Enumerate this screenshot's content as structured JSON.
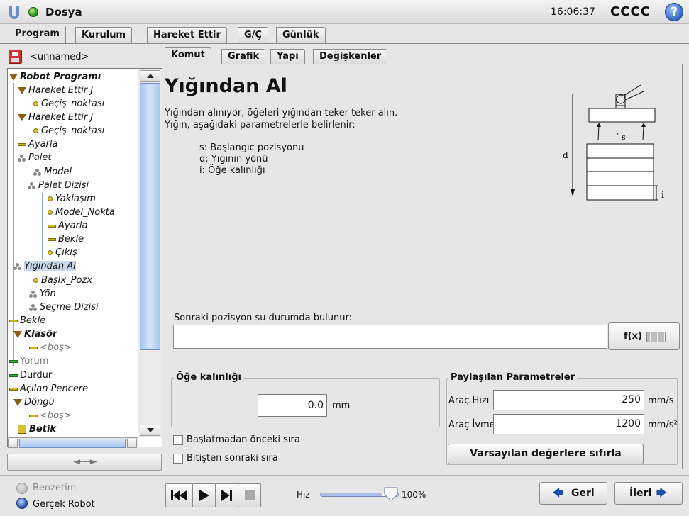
{
  "topbar": {
    "app_title": "Dosya",
    "clock": "16:06:37",
    "robot_name": "CCCC",
    "help_label": "?"
  },
  "main_tabs": [
    {
      "label": "Program",
      "active": true
    },
    {
      "label": "Kurulum",
      "active": false
    },
    {
      "label": "Hareket Ettir",
      "active": false
    },
    {
      "label": "G/Ç",
      "active": false
    },
    {
      "label": "Günlük",
      "active": false
    }
  ],
  "file": {
    "name": "<unnamed>"
  },
  "tree": [
    {
      "label": "Robot Programı",
      "icon": "triangle"
    },
    {
      "label": "Hareket Ettir J",
      "icon": "triangle"
    },
    {
      "label": "Geçiş_noktası",
      "icon": "waypoint-dot"
    },
    {
      "label": "Hareket Ettir J",
      "icon": "triangle"
    },
    {
      "label": "Geçiş_noktası",
      "icon": "waypoint-dot"
    },
    {
      "label": "Ayarla",
      "icon": "dash"
    },
    {
      "label": "Palet",
      "icon": "pallet"
    },
    {
      "label": "Model",
      "icon": "pallet"
    },
    {
      "label": "Palet Dizisi",
      "icon": "pallet"
    },
    {
      "label": "Yaklaşım",
      "icon": "waypoint-dot"
    },
    {
      "label": "Model_Nokta",
      "icon": "waypoint-dot"
    },
    {
      "label": "Ayarla",
      "icon": "dash"
    },
    {
      "label": "Bekle",
      "icon": "dash"
    },
    {
      "label": "Çıkış",
      "icon": "waypoint-dot"
    },
    {
      "label": "Yığından Al",
      "icon": "pallet"
    },
    {
      "label": "BaşIx_Pozx",
      "icon": "waypoint-dot"
    },
    {
      "label": "Yön",
      "icon": "pallet"
    },
    {
      "label": "Seçme Dizisi",
      "icon": "pallet"
    },
    {
      "label": "Bekle",
      "icon": "dash"
    },
    {
      "label": "Klasör",
      "icon": "triangle"
    },
    {
      "label": "<boş>",
      "icon": "dash"
    },
    {
      "label": "Yorum",
      "icon": "dash-green"
    },
    {
      "label": "Durdur",
      "icon": "dash-green"
    },
    {
      "label": "Açılan Pencere",
      "icon": "dash"
    },
    {
      "label": "Döngü",
      "icon": "triangle"
    },
    {
      "label": "<boş>",
      "icon": "dash"
    },
    {
      "label": "Betik",
      "icon": "script"
    }
  ],
  "collapse_button": {
    "label": "◄----►"
  },
  "sub_tabs": [
    {
      "label": "Komut",
      "active": true
    },
    {
      "label": "Grafik",
      "active": false
    },
    {
      "label": "Yapı",
      "active": false
    },
    {
      "label": "Değişkenler",
      "active": false
    }
  ],
  "main": {
    "title": "Yığından Al",
    "description_1": "Yığından alınıyor, öğeleri yığından teker teker alın.",
    "description_2": "Yığın, aşağıdaki parametrelerle belirlenir:",
    "params": [
      "s: Başlangıç pozisyonu",
      "d: Yığının yönü",
      "i: Öğe kalınlığı"
    ],
    "diagram": {
      "d_label": "d",
      "s_label": "s",
      "i_label": "i"
    },
    "next_position_label": "Sonraki pozisyon şu durumda bulunur:",
    "next_position_value": "",
    "fx_label": "f(x)",
    "thickness_group": {
      "title": "Öğe kalınlığı",
      "value": "0.0",
      "unit": "mm"
    },
    "start_seq_label": "Başlatmadan önceki sıra",
    "end_seq_label": "Bitişten sonraki sıra",
    "shared_params": {
      "title": "Paylaşılan Parametreler",
      "tool_speed_label": "Araç Hızı",
      "tool_speed_value": "250",
      "tool_speed_unit": "mm/s",
      "tool_accel_label": "Araç İvmesi",
      "tool_accel_value": "1200",
      "tool_accel_unit": "mm/s²",
      "reset_label": "Varsayılan değerlere sıfırla"
    }
  },
  "bottom": {
    "sim_label": "Benzetim",
    "real_label": "Gerçek Robot",
    "speed_label": "Hız",
    "speed_value": "100%",
    "speed_fraction": 1.0,
    "back_label": "Geri",
    "next_label": "İleri"
  },
  "colors": {
    "accent": "#2f67c0",
    "selected": "#c8d8ef",
    "status_ok": "#2f9a1a"
  }
}
